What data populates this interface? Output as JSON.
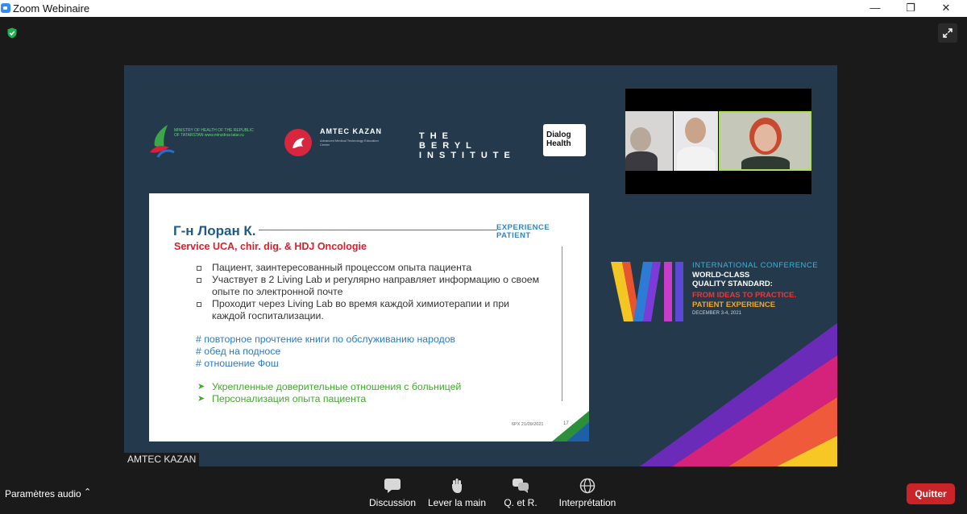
{
  "window": {
    "title": "Zoom Webinaire",
    "controls": {
      "minimize": "—",
      "maximize": "❐",
      "close": "✕"
    }
  },
  "meeting": {
    "security_icon": "shield-check-icon",
    "fullscreen_icon": "expand-icon",
    "speaker_label": "AMTEC KAZAN"
  },
  "share": {
    "logos": {
      "ministry": "MINISTRY OF HEALTH OF THE REPUBLIC OF TATARSTAN www.minzdrav.tatar.ru",
      "amtec": "AMTEC KAZAN",
      "amtec_sub": "Advanced Medical Technology Education Center",
      "beryl": "THE BERYL INSTITUTE",
      "dialog": "Dialog Health"
    },
    "slide": {
      "name": "Г-н Лоран К.",
      "service": "Service UCA, chir. dig. & HDJ Oncologie",
      "badge": "EXPERIENCE PATIENT",
      "bullets": [
        "Пациент, заинтересованный процессом опыта пациента",
        "Участвует в 2 Living Lab и регулярно направляет информацию о своем опыте по электронной почте",
        "Проходит через Living Lab во время каждой химиотерапии и при каждой госпитализации."
      ],
      "tags": [
        "# повторное прочтение книги по обслуживанию народов",
        "# обед на подносе",
        "# отношение Фош"
      ],
      "outcomes": [
        "Укрепленные доверительные отношения с больницей",
        "Персонализация опыта пациента"
      ],
      "footer": "6PX 21/09/2021",
      "page": "17"
    },
    "conference": {
      "line1": "INTERNATIONAL CONFERENCE",
      "line2": "WORLD-CLASS",
      "line3": "QUALITY STANDARD:",
      "line4": "FROM IDEAS TO PRACTICE.",
      "line5": "PATIENT EXPERIENCE",
      "date": "DECEMBER 3-4, 2021"
    }
  },
  "toolbar": {
    "audio_label": "Paramètres audio",
    "chat_label": "Discussion",
    "hand_label": "Lever la main",
    "qa_label": "Q. et R.",
    "interp_label": "Interprétation",
    "quit_label": "Quitter"
  },
  "colors": {
    "accent_blue": "#2d8cff",
    "quit_red": "#c8242a",
    "slide_bg": "#243a4c",
    "active_speaker": "#a9e24b"
  }
}
